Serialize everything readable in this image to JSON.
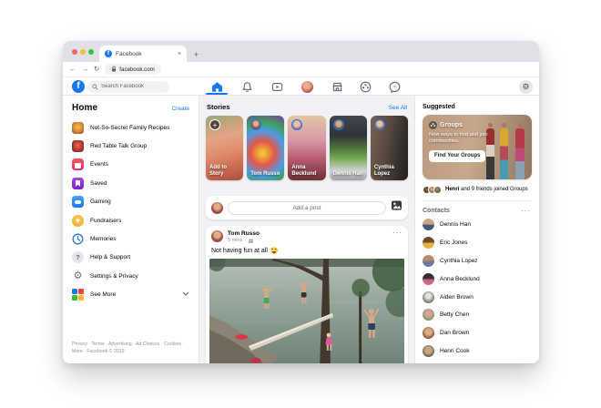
{
  "browser": {
    "tab_title": "Facebook",
    "tab_close": "×",
    "new_tab": "+",
    "back": "←",
    "forward": "→",
    "reload": "↻",
    "url": "facebook.com"
  },
  "header": {
    "logo_letter": "f",
    "search_placeholder": "Search Facebook",
    "nav_icons": [
      "home",
      "notifications",
      "watch",
      "profile",
      "marketplace",
      "groups",
      "messenger"
    ],
    "settings_glyph": "⚙"
  },
  "sidebar": {
    "title": "Home",
    "create_label": "Create",
    "items": [
      {
        "icon": "recipes-thumbnail",
        "label": "Not-So-Secret Family Recipes"
      },
      {
        "icon": "red-table-thumbnail",
        "label": "Red Table Talk Group"
      },
      {
        "icon": "events",
        "label": "Events"
      },
      {
        "icon": "saved",
        "label": "Saved"
      },
      {
        "icon": "gaming",
        "label": "Gaming"
      },
      {
        "icon": "fundraisers",
        "label": "Fundraisers",
        "glyph": "♥"
      },
      {
        "icon": "memories",
        "label": "Memories"
      },
      {
        "icon": "help",
        "label": "Help & Support",
        "glyph": "?"
      },
      {
        "icon": "settings",
        "label": "Settings & Privacy",
        "glyph": "⚙"
      },
      {
        "icon": "see-more-grid",
        "label": "See More"
      }
    ],
    "footer": "Privacy · Terms · Advertising · Ad Choices · Cookies · More · Facebook © 2019"
  },
  "feed": {
    "stories": {
      "title": "Stories",
      "see_all_label": "See All",
      "cards": [
        {
          "name": "Add to Story",
          "type": "add"
        },
        {
          "name": "Tom Russo"
        },
        {
          "name": "Anna Becklund"
        },
        {
          "name": "Dennis Han"
        },
        {
          "name": "Cynthia Lopez"
        }
      ]
    },
    "composer": {
      "placeholder": "Add a post"
    },
    "post": {
      "author": "Tom Russo",
      "time": "5 mins",
      "dot": "·",
      "menu": "···",
      "text": "Not having fun at all",
      "emoji": "😆"
    }
  },
  "right": {
    "suggested_title": "Suggested",
    "groups_card": {
      "title": "Groups",
      "subtitle": "New ways to find and join communities.",
      "button_label": "Find Your Groups"
    },
    "joined": {
      "bold": "Henri",
      "rest": " and 9 friends joined Groups"
    },
    "contacts_title": "Contacts",
    "contacts_more": "···",
    "contacts": [
      "Dennis Han",
      "Eric Jones",
      "Cynthia Lopez",
      "Anna Becklund",
      "Aiden Brown",
      "Betty Chen",
      "Dan Brown",
      "Henri Cook"
    ]
  },
  "colors": {
    "facebook_blue": "#1877f2",
    "traffic_red": "#ff5f57",
    "traffic_yellow": "#febc2e",
    "traffic_green": "#28c840",
    "feed_background": "#f0f2f5"
  }
}
